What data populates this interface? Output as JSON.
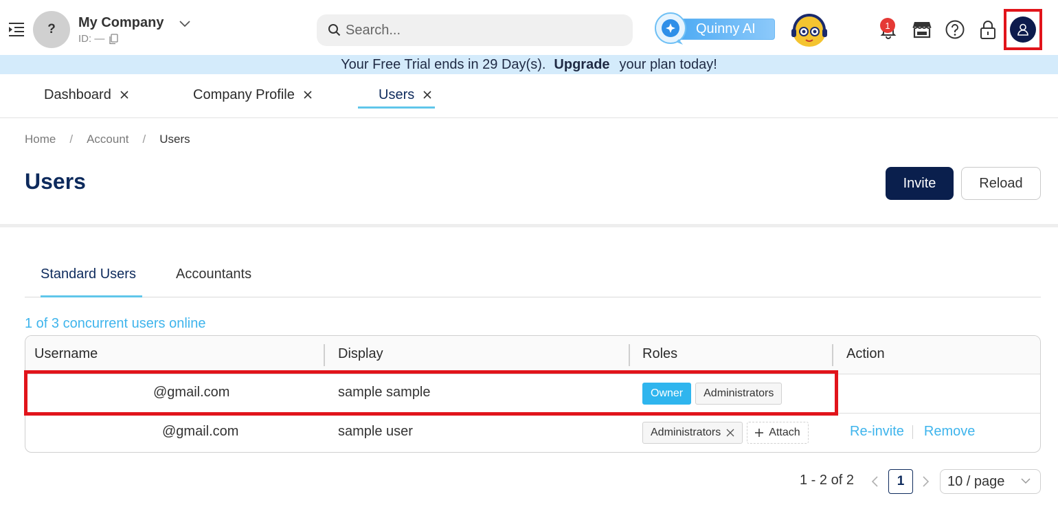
{
  "header": {
    "company_avatar": "?",
    "company_name": "My Company",
    "company_id": "ID: —",
    "search_placeholder": "Search...",
    "ai_label": "Quinny AI",
    "notification_count": "1"
  },
  "banner": {
    "prefix": "Your Free Trial ends in 29 Day(s).",
    "link": "Upgrade",
    "suffix": "your plan today!"
  },
  "page_tabs": [
    {
      "label": "Dashboard"
    },
    {
      "label": "Company Profile"
    },
    {
      "label": "Users",
      "active": true
    }
  ],
  "breadcrumb": [
    "Home",
    "Account",
    "Users"
  ],
  "page": {
    "title": "Users",
    "invite_label": "Invite",
    "reload_label": "Reload"
  },
  "user_tabs": [
    {
      "label": "Standard Users",
      "active": true
    },
    {
      "label": "Accountants"
    }
  ],
  "online_status": "1 of 3 concurrent users online",
  "table": {
    "columns": [
      "Username",
      "Display",
      "Roles",
      "Action"
    ],
    "rows": [
      {
        "username": "@gmail.com",
        "display": "sample sample",
        "roles": [
          "Owner",
          "Administrators"
        ]
      },
      {
        "username": "@gmail.com",
        "display": "sample user",
        "roles": [
          "Administrators"
        ],
        "attach_label": "Attach",
        "actions": [
          "Re-invite",
          "Remove"
        ]
      }
    ]
  },
  "pagination": {
    "total_text": "1 - 2 of 2",
    "current_page": "1",
    "page_size": "10 / page"
  },
  "colors": {
    "brand_navy": "#0a1f4d",
    "accent_cyan": "#3eb4ec",
    "banner_bg": "#d4ebfb",
    "highlight_red": "#e1141b"
  }
}
